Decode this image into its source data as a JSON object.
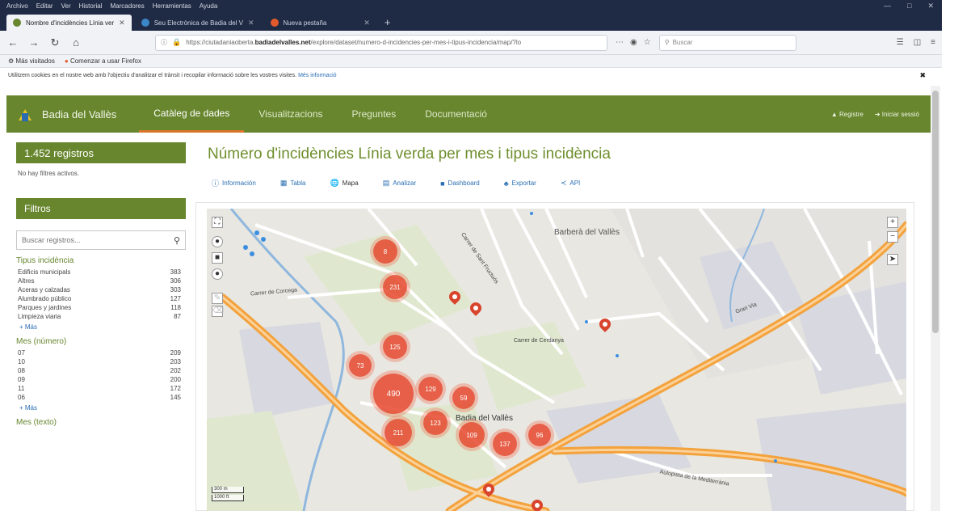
{
  "browser": {
    "menu": [
      "Archivo",
      "Editar",
      "Ver",
      "Historial",
      "Marcadores",
      "Herramientas",
      "Ayuda"
    ],
    "tabs": [
      {
        "label": "Nombre d'incidències Línia ver",
        "active": true
      },
      {
        "label": "Seu Electrònica de Badia del V",
        "active": false
      },
      {
        "label": "Nueva pestaña",
        "active": false
      }
    ],
    "url_prefix": "https://ciutadaniaoberta.",
    "url_domain": "badiadelvalles.net",
    "url_suffix": "/explore/dataset/numero-d-incidencies-per-mes-i-tipus-incidencia/map/?lo",
    "search_placeholder": "Buscar",
    "bookmarks": [
      "Más visitados",
      "Comenzar a usar Firefox"
    ],
    "cookie_text": "Utilitzem cookies en el nostre web amb l'objectiu d'analitzar el trànsit i recopilar informació sobre les vostres visites.",
    "cookie_link": "Més informació"
  },
  "site": {
    "name": "Badia del Vallès",
    "nav": [
      "Catàleg de dades",
      "Visualitzacions",
      "Preguntes",
      "Documentació"
    ],
    "register": "Registre",
    "login": "Iniciar sessió"
  },
  "sidebar": {
    "count": "1.452 registros",
    "no_filters": "No hay filtres activos.",
    "filters_title": "Filtros",
    "search_placeholder": "Buscar registros...",
    "facets": [
      {
        "title": "Tipus incidència",
        "items": [
          {
            "label": "Edificis municipals",
            "count": "383"
          },
          {
            "label": "Altres",
            "count": "306"
          },
          {
            "label": "Aceras y calzadas",
            "count": "303"
          },
          {
            "label": "Alumbrado público",
            "count": "127"
          },
          {
            "label": "Parques y jardines",
            "count": "118"
          },
          {
            "label": "Limpieza viaria",
            "count": "87"
          }
        ],
        "more": "+ Más"
      },
      {
        "title": "Mes (número)",
        "items": [
          {
            "label": "07",
            "count": "209"
          },
          {
            "label": "10",
            "count": "203"
          },
          {
            "label": "08",
            "count": "202"
          },
          {
            "label": "09",
            "count": "200"
          },
          {
            "label": "11",
            "count": "172"
          },
          {
            "label": "06",
            "count": "145"
          }
        ],
        "more": "+ Más"
      }
    ],
    "next_facet": "Mes (texto)"
  },
  "main": {
    "title": "Número d'incidències Línia verda per mes i tipus incidència",
    "tabs": [
      "Información",
      "Tabla",
      "Mapa",
      "Analizar",
      "Dashboard",
      "Exportar",
      "API"
    ],
    "active_tab": "Mapa"
  },
  "map": {
    "place": "Barberà del Vallès",
    "town_label": "Badia del Vallès",
    "clusters": [
      "8",
      "231",
      "125",
      "73",
      "490",
      "129",
      "59",
      "211",
      "123",
      "109",
      "137",
      "96"
    ],
    "zoom_in": "+",
    "zoom_out": "−",
    "scale_m": "300 m",
    "scale_ft": "1000 ft",
    "street_labels": [
      "Carrer de Corcega",
      "Autopista de la Mediterrània",
      "Carrer de Sant Fructuós",
      "Gran Via",
      "Carrer de Cerdanya"
    ]
  }
}
